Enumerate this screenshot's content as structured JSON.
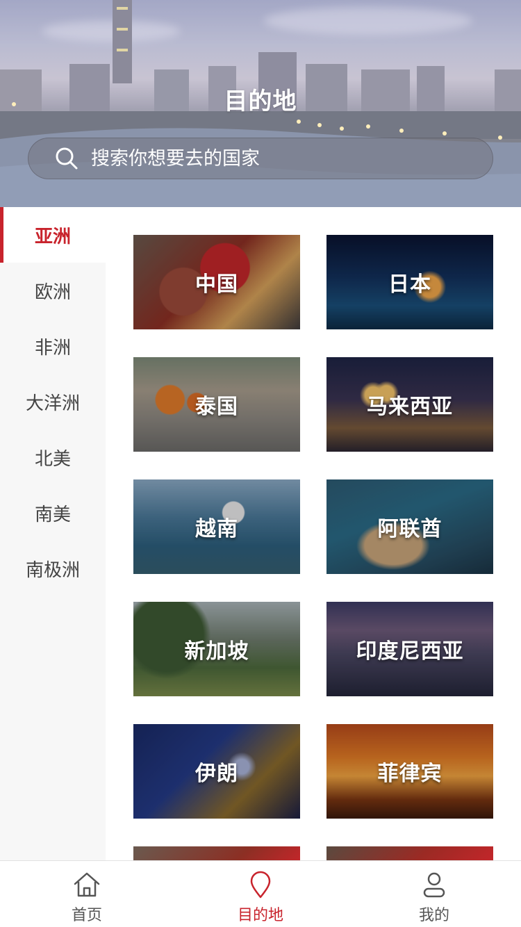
{
  "header": {
    "title": "目的地",
    "search_placeholder": "搜索你想要去的国家"
  },
  "sidebar": {
    "items": [
      {
        "label": "亚洲",
        "active": true
      },
      {
        "label": "欧洲",
        "active": false
      },
      {
        "label": "非洲",
        "active": false
      },
      {
        "label": "大洋洲",
        "active": false
      },
      {
        "label": "北美",
        "active": false
      },
      {
        "label": "南美",
        "active": false
      },
      {
        "label": "南极洲",
        "active": false
      }
    ]
  },
  "countries": [
    {
      "label": "中国"
    },
    {
      "label": "日本"
    },
    {
      "label": "泰国"
    },
    {
      "label": "马来西亚"
    },
    {
      "label": "越南"
    },
    {
      "label": "阿联酋"
    },
    {
      "label": "新加坡"
    },
    {
      "label": "印度尼西亚"
    },
    {
      "label": "伊朗"
    },
    {
      "label": "菲律宾"
    }
  ],
  "tabbar": {
    "items": [
      {
        "label": "首页",
        "icon": "home-icon",
        "active": false
      },
      {
        "label": "目的地",
        "icon": "location-pin-icon",
        "active": true
      },
      {
        "label": "我的",
        "icon": "user-icon",
        "active": false
      }
    ]
  },
  "colors": {
    "accent": "#c8232c",
    "sidebar_bg": "#f7f7f7",
    "text_default": "#444444"
  }
}
